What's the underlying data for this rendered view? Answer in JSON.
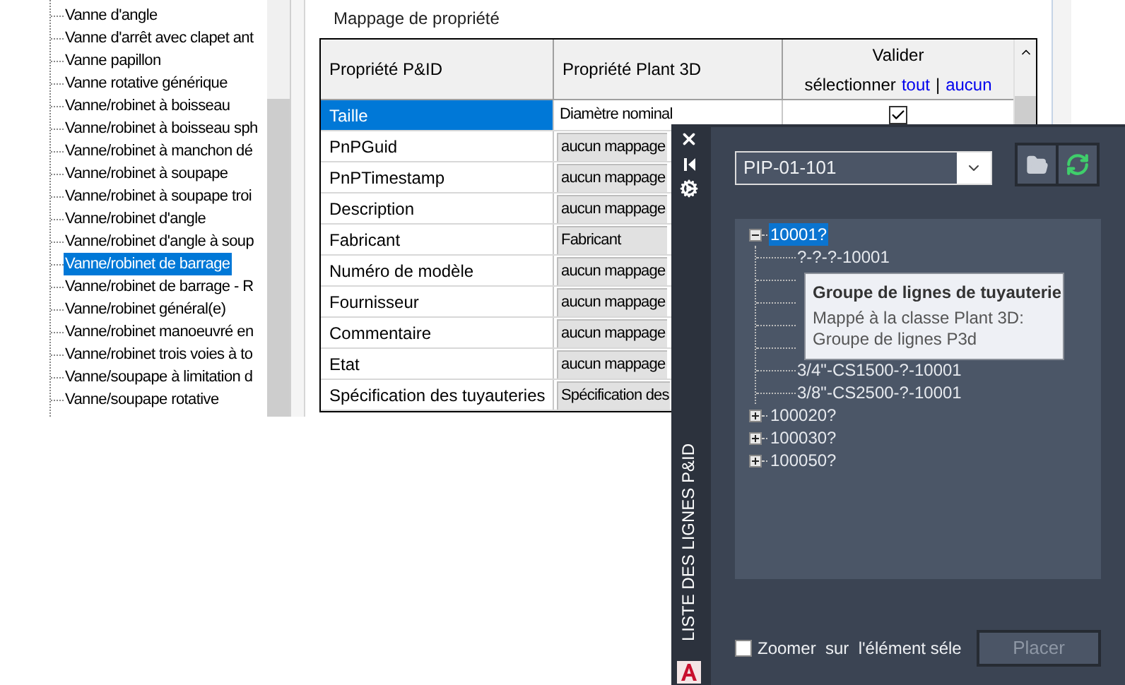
{
  "class_tree": {
    "items": [
      {
        "label": "Vanne d'angle",
        "selected": false
      },
      {
        "label": "Vanne d'arrêt avec clapet ant",
        "selected": false
      },
      {
        "label": "Vanne papillon",
        "selected": false
      },
      {
        "label": "Vanne rotative générique",
        "selected": false
      },
      {
        "label": "Vanne/robinet à boisseau",
        "selected": false
      },
      {
        "label": "Vanne/robinet à boisseau sph",
        "selected": false
      },
      {
        "label": "Vanne/robinet à manchon dé",
        "selected": false
      },
      {
        "label": "Vanne/robinet à soupape",
        "selected": false
      },
      {
        "label": "Vanne/robinet à soupape troi",
        "selected": false
      },
      {
        "label": "Vanne/robinet d'angle",
        "selected": false
      },
      {
        "label": "Vanne/robinet d'angle à soup",
        "selected": false
      },
      {
        "label": "Vanne/robinet de barrage",
        "selected": true
      },
      {
        "label": "Vanne/robinet de barrage - R",
        "selected": false
      },
      {
        "label": "Vanne/robinet général(e)",
        "selected": false
      },
      {
        "label": "Vanne/robinet manoeuvré en",
        "selected": false
      },
      {
        "label": "Vanne/robinet trois voies à to",
        "selected": false
      },
      {
        "label": "Vanne/soupape à limitation d",
        "selected": false
      },
      {
        "label": "Vanne/soupape rotative",
        "selected": false
      }
    ]
  },
  "mapping": {
    "title": "Mappage de propriété",
    "columns": {
      "pid": "Propriété P&ID",
      "plant3d": "Propriété Plant 3D",
      "validate": "Valider",
      "select_label": "sélectionner",
      "select_all": "tout",
      "separator": "|",
      "select_none": "aucun"
    },
    "rows": [
      {
        "pid": "Taille",
        "plant3d": "Diamètre nominal",
        "selected": true,
        "checked": true
      },
      {
        "pid": "PnPGuid",
        "plant3d": "aucun mappage",
        "selected": false
      },
      {
        "pid": "PnPTimestamp",
        "plant3d": "aucun mappage",
        "selected": false
      },
      {
        "pid": "Description",
        "plant3d": "aucun mappage",
        "selected": false
      },
      {
        "pid": "Fabricant",
        "plant3d": "Fabricant",
        "selected": false
      },
      {
        "pid": "Numéro de modèle",
        "plant3d": "aucun mappage",
        "selected": false
      },
      {
        "pid": "Fournisseur",
        "plant3d": "aucun mappage",
        "selected": false
      },
      {
        "pid": "Commentaire",
        "plant3d": "aucun mappage",
        "selected": false
      },
      {
        "pid": "Etat",
        "plant3d": "aucun mappage",
        "selected": false
      },
      {
        "pid": "Spécification des tuyauteries",
        "plant3d": "Spécification des",
        "selected": false
      }
    ]
  },
  "palette": {
    "title": "LISTE DES LIGNES P&ID",
    "drawing": "PIP-01-101",
    "tree": [
      {
        "label": "10001?",
        "expanded": true,
        "selected": true,
        "children": [
          {
            "kind": "item",
            "label": "?-?-?-10001"
          },
          {
            "kind": "tooltip",
            "title": "Groupe de lignes de tuyauterie",
            "lines": [
              "Mappé à la classe Plant 3D:",
              "Groupe de lignes P3d"
            ]
          },
          {
            "kind": "item",
            "label": "3/4\"-CS1500-?-10001"
          },
          {
            "kind": "item",
            "label": "3/8\"-CS2500-?-10001"
          }
        ]
      },
      {
        "label": "100020?",
        "expanded": false,
        "selected": false
      },
      {
        "label": "100030?",
        "expanded": false,
        "selected": false
      },
      {
        "label": "100050?",
        "expanded": false,
        "selected": false
      }
    ],
    "zoom_option": {
      "label": "Zoomer  sur  l'élément séle",
      "checked": false
    },
    "place_button": {
      "label": "Placer",
      "disabled": true
    }
  }
}
